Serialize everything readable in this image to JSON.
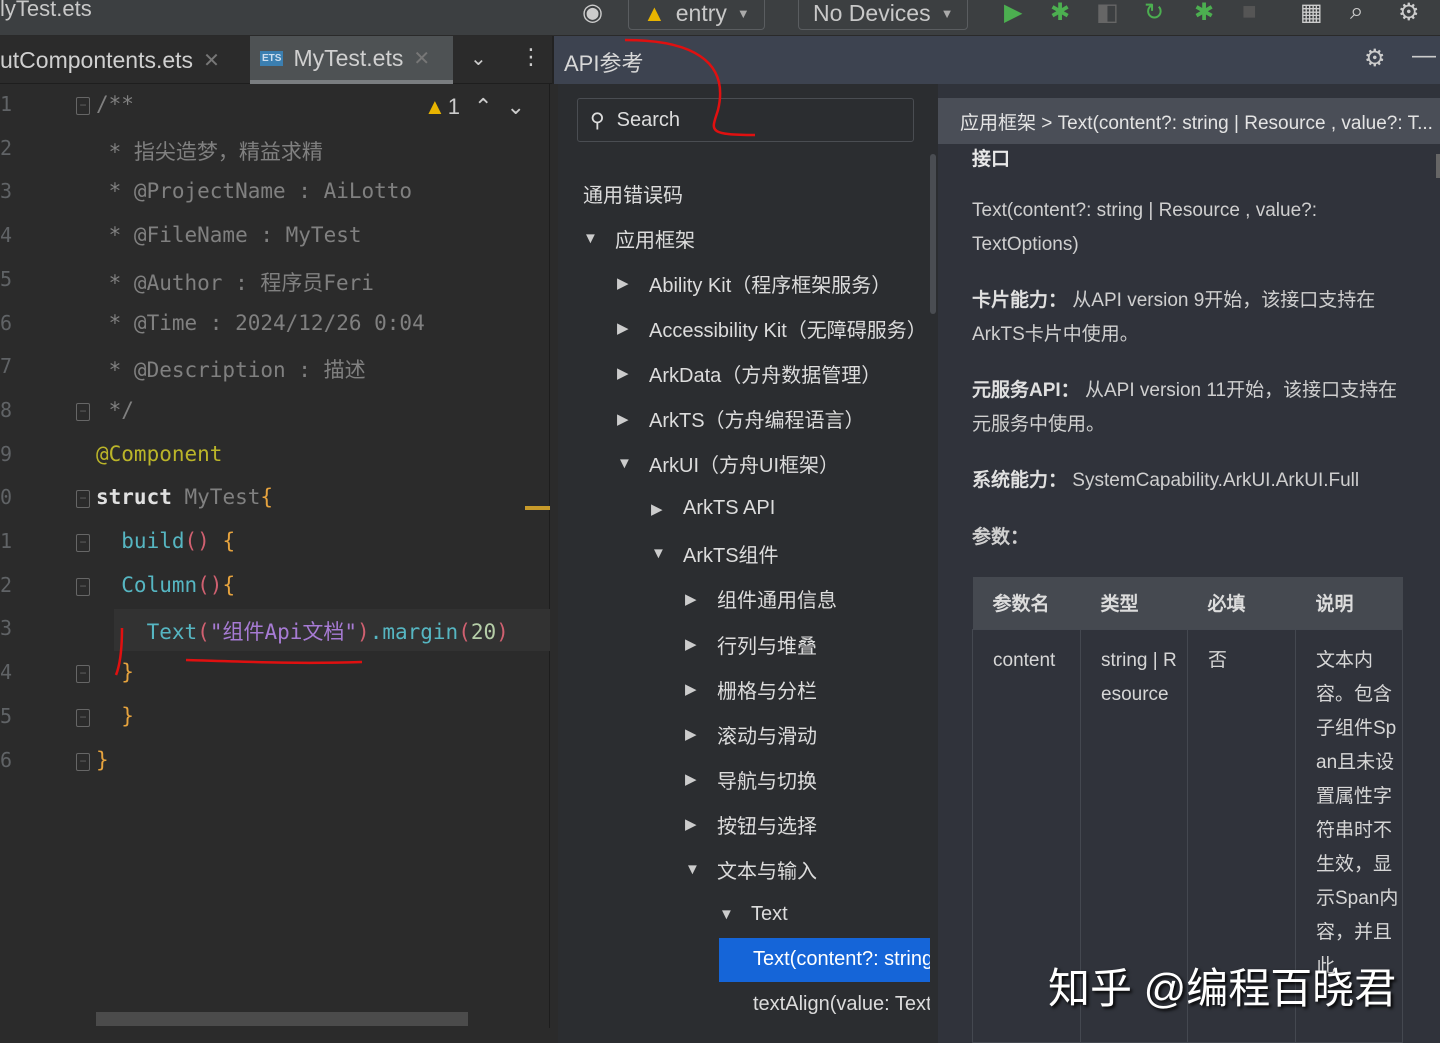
{
  "window": {
    "title": "lyTest.ets"
  },
  "toolbar": {
    "module": "entry",
    "device": "No Devices"
  },
  "tabs": [
    {
      "label": "utCompontents.ets"
    },
    {
      "label": "MyTest.ets",
      "badge": "ETS"
    }
  ],
  "editor": {
    "warnings": "1",
    "lines": [
      [
        [
          "/**",
          "t-comment"
        ]
      ],
      [
        [
          " * 指尖造梦，精益求精",
          "t-comment"
        ]
      ],
      [
        [
          " * @ProjectName : AiLotto",
          "t-comment"
        ]
      ],
      [
        [
          " * @FileName : MyTest",
          "t-comment"
        ]
      ],
      [
        [
          " * @Author : 程序员Feri",
          "t-comment"
        ]
      ],
      [
        [
          " * @Time : 2024/12/26 0:04",
          "t-comment"
        ]
      ],
      [
        [
          " * @Description : 描述",
          "t-comment"
        ]
      ],
      [
        [
          " */",
          "t-comment"
        ]
      ],
      [
        [
          "@Component",
          "t-anno"
        ]
      ],
      [
        [
          "struct ",
          "t-kw"
        ],
        [
          "MyTest",
          "t-cls"
        ],
        [
          "{",
          "t-brace"
        ]
      ],
      [
        [
          "  build",
          "t-fn"
        ],
        [
          "()",
          "t-paren"
        ],
        [
          " {",
          "t-brace"
        ]
      ],
      [
        [
          "  Column",
          "t-fn"
        ],
        [
          "()",
          "t-paren"
        ],
        [
          "{",
          "t-brace"
        ]
      ],
      [
        [
          "    Text",
          "t-fn"
        ],
        [
          "(",
          "t-paren"
        ],
        [
          "\"组件Api文档\"",
          "t-str"
        ],
        [
          ")",
          "t-paren"
        ],
        [
          ".margin",
          "t-fn"
        ],
        [
          "(",
          "t-paren"
        ],
        [
          "20",
          "t-num"
        ],
        [
          ")",
          "t-paren"
        ]
      ],
      [
        [
          "  }",
          "t-brace"
        ]
      ],
      [
        [
          "  }",
          "t-brace"
        ]
      ],
      [
        [
          "}",
          "t-brace"
        ]
      ]
    ]
  },
  "api_panel": {
    "title": "API参考",
    "search_placeholder": "Search",
    "tree": [
      {
        "label": "通用错误码",
        "level": 0,
        "caret": ""
      },
      {
        "label": "应用框架",
        "level": 0,
        "caret": "down"
      },
      {
        "label": "Ability Kit（程序框架服务）",
        "level": 1,
        "caret": "right"
      },
      {
        "label": "Accessibility Kit（无障碍服务）",
        "level": 1,
        "caret": "right"
      },
      {
        "label": "ArkData（方舟数据管理）",
        "level": 1,
        "caret": "right"
      },
      {
        "label": "ArkTS（方舟编程语言）",
        "level": 1,
        "caret": "right"
      },
      {
        "label": "ArkUI（方舟UI框架）",
        "level": 1,
        "caret": "down"
      },
      {
        "label": "ArkTS API",
        "level": 2,
        "caret": "right"
      },
      {
        "label": "ArkTS组件",
        "level": 2,
        "caret": "down"
      },
      {
        "label": "组件通用信息",
        "level": 3,
        "caret": "right"
      },
      {
        "label": "行列与堆叠",
        "level": 3,
        "caret": "right"
      },
      {
        "label": "栅格与分栏",
        "level": 3,
        "caret": "right"
      },
      {
        "label": "滚动与滑动",
        "level": 3,
        "caret": "right"
      },
      {
        "label": "导航与切换",
        "level": 3,
        "caret": "right"
      },
      {
        "label": "按钮与选择",
        "level": 3,
        "caret": "right"
      },
      {
        "label": "文本与输入",
        "level": 3,
        "caret": "down"
      },
      {
        "label": "Text",
        "level": 4,
        "caret": "down"
      },
      {
        "label": "Text(content?: string",
        "level": 5,
        "caret": "",
        "selected": true
      },
      {
        "label": "textAlign(value: TextA",
        "level": 5,
        "caret": ""
      }
    ]
  },
  "doc": {
    "breadcrumb": "应用框架 > Text(content?: string | Resource , value?: T...",
    "heading": "接口",
    "signature": "Text(content?: string | Resource , value?: TextOptions)",
    "card_label": "卡片能力：",
    "card_text": "从API version 9开始，该接口支持在ArkTS卡片中使用。",
    "atomic_label": "元服务API：",
    "atomic_text": "从API version 11开始，该接口支持在元服务中使用。",
    "syscap_label": "系统能力：",
    "syscap_text": "SystemCapability.ArkUI.ArkUI.Full",
    "params_label": "参数：",
    "table": {
      "headers": [
        "参数名",
        "类型",
        "必填",
        "说明"
      ],
      "rows": [
        [
          "content",
          "string | Resource",
          "否",
          "文本内容。包含子组件Span且未设置属性字符串时不生效，显示Span内容，并且此"
        ]
      ]
    }
  },
  "watermark": "知乎 @编程百晓君"
}
